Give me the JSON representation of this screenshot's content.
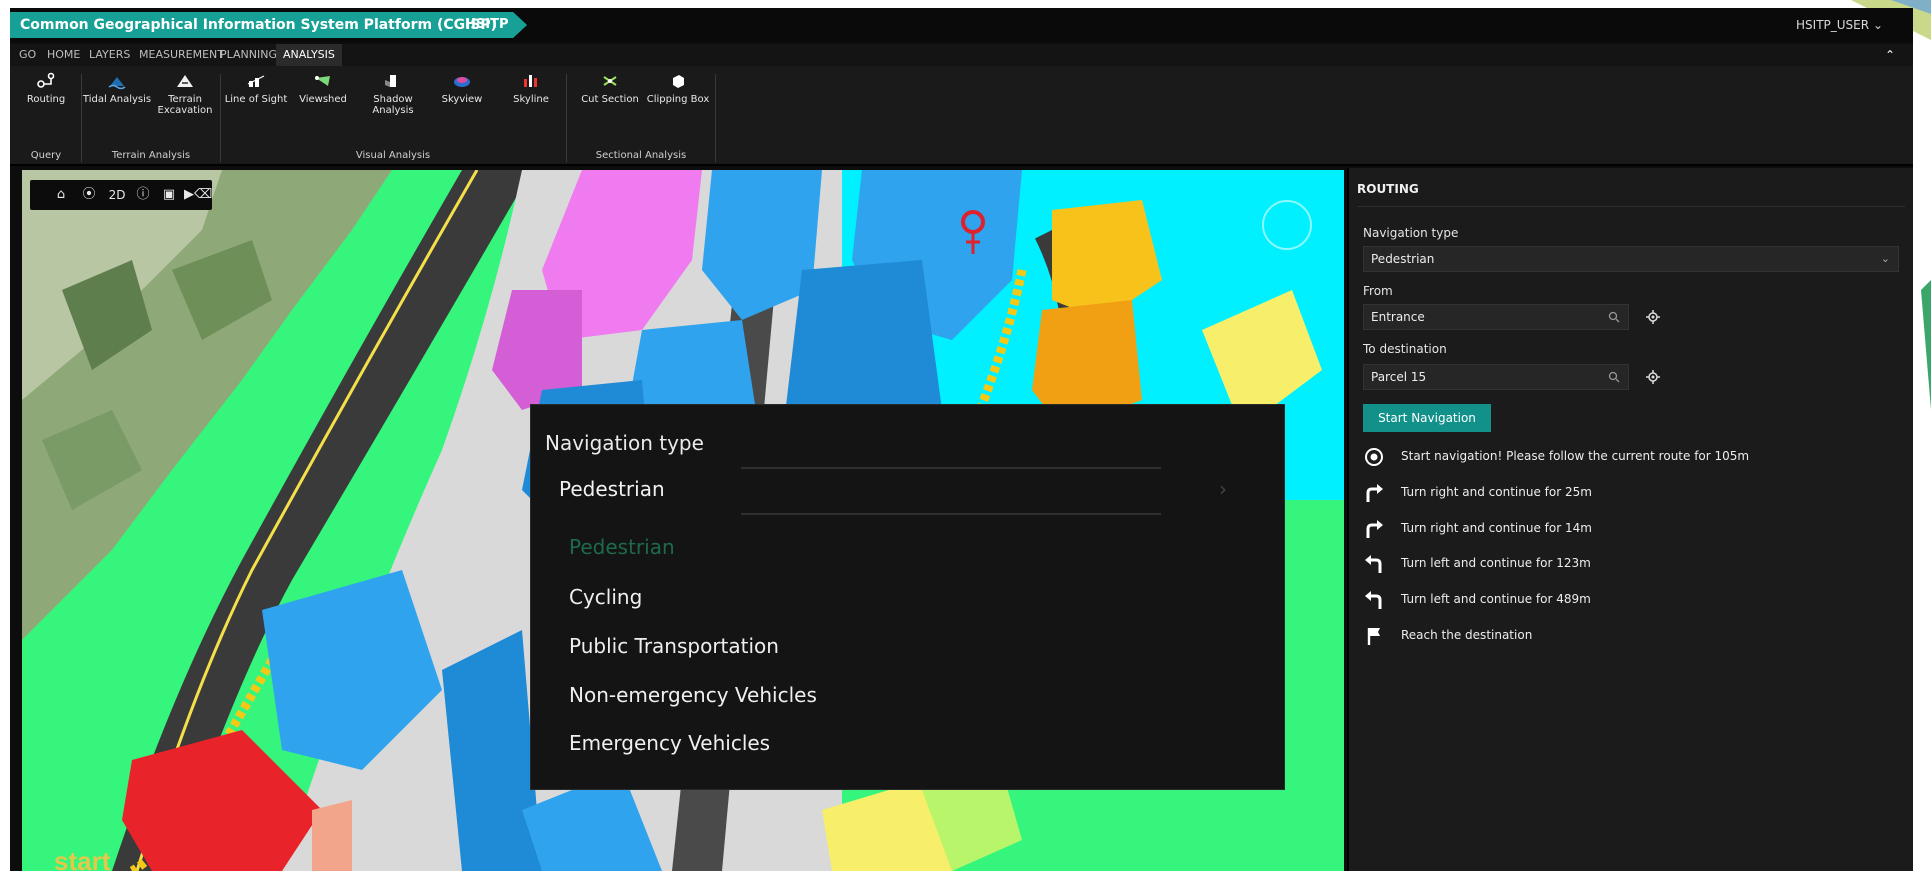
{
  "window": {
    "app_title": "Common Geographical Information System Platform (CGISP)",
    "project": "HSITP",
    "user": "HSITP_USER"
  },
  "menu": {
    "tabs": [
      "GO",
      "HOME",
      "LAYERS",
      "MEASUREMENT",
      "PLANNING",
      "ANALYSIS"
    ],
    "active": "ANALYSIS"
  },
  "ribbon": {
    "tools": {
      "routing": "Routing",
      "tidal": "Tidal Analysis",
      "terrain": "Terrain Excavation",
      "line_of_sight": "Line of Sight",
      "viewshed": "Viewshed",
      "shadow": "Shadow Analysis",
      "skyview": "Skyview",
      "skyline": "Skyline",
      "cut_section": "Cut Section",
      "clipping_box": "Clipping Box"
    },
    "groups": {
      "query": "Query",
      "terrain": "Terrain Analysis",
      "visual": "Visual Analysis",
      "sectional": "Sectional Analysis"
    }
  },
  "map": {
    "toolbar_mode": "2D",
    "start_label": "start",
    "colors": {
      "grass": "#35f57c",
      "water": "#00f0ff",
      "building_blue": "#2fa3ee",
      "building_magenta": "#f07af0",
      "building_yellow": "#f7c21a",
      "building_red": "#e8242a",
      "road": "#3a3a3a",
      "route": "#f5c816"
    }
  },
  "overlay": {
    "label": "Navigation type",
    "selected": "Pedestrian",
    "options": [
      "Pedestrian",
      "Cycling",
      "Public Transportation",
      "Non-emergency Vehicles",
      "Emergency Vehicles"
    ]
  },
  "panel": {
    "title": "ROUTING",
    "nav_type_label": "Navigation type",
    "nav_type_value": "Pedestrian",
    "from_label": "From",
    "from_value": "Entrance",
    "to_label": "To destination",
    "to_value": "Parcel 15",
    "start_button": "Start Navigation",
    "steps": [
      {
        "icon": "location-start-icon",
        "text": "Start navigation! Please follow the current route for 105m"
      },
      {
        "icon": "turn-right-icon",
        "text": "Turn right and continue for 25m"
      },
      {
        "icon": "turn-right-icon",
        "text": "Turn right and continue for 14m"
      },
      {
        "icon": "turn-left-icon",
        "text": "Turn left and continue for 123m"
      },
      {
        "icon": "turn-left-icon",
        "text": "Turn left and continue for 489m"
      },
      {
        "icon": "flag-icon",
        "text": "Reach the destination"
      }
    ]
  }
}
